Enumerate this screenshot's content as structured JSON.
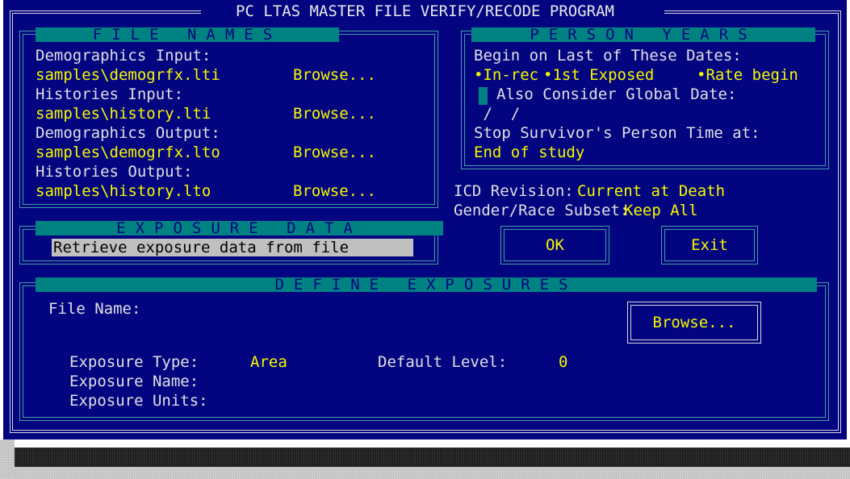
{
  "window": {
    "title": "PC LTAS MASTER FILE VERIFY/RECODE PROGRAM"
  },
  "file_names": {
    "header": "FILE NAMES",
    "rows": [
      {
        "label": "Demographics Input:",
        "value": "samples\\demogrfx.lti",
        "browse": "Browse..."
      },
      {
        "label": "Histories Input:",
        "value": "samples\\history.lti",
        "browse": "Browse..."
      },
      {
        "label": "Demographics Output:",
        "value": "samples\\demogrfx.lto",
        "browse": "Browse..."
      },
      {
        "label": "Histories Output:",
        "value": "samples\\history.lto",
        "browse": "Browse..."
      }
    ]
  },
  "person_years": {
    "header": "PERSON YEARS",
    "begin_label": "Begin on Last of These Dates:",
    "options": [
      "•In-rec",
      "•1st Exposed",
      "•Rate begin"
    ],
    "global_date_label": "Also Consider Global Date:",
    "global_date_value": " /  /",
    "stop_label": "Stop Survivor's Person Time at:",
    "stop_value": "End of study"
  },
  "settings": {
    "icd_label": "ICD Revision:",
    "icd_value": "Current at Death",
    "subset_label": "Gender/Race Subset:",
    "subset_value": "Keep All"
  },
  "exposure_data": {
    "header": "EXPOSURE DATA",
    "selection": "Retrieve exposure data from file"
  },
  "buttons": {
    "ok": "OK",
    "exit": "Exit"
  },
  "define_exposures": {
    "header": "DEFINE EXPOSURES",
    "file_name_label": "File Name:",
    "browse": "Browse...",
    "type_label": "Exposure Type:",
    "type_value": "Area",
    "default_level_label": "Default Level:",
    "default_level_value": "0",
    "name_label": "Exposure Name:",
    "units_label": "Exposure Units:"
  },
  "colors": {
    "background": "#020480",
    "highlight": "#f8f800",
    "band": "#008282",
    "text": "#e0e0e0"
  }
}
